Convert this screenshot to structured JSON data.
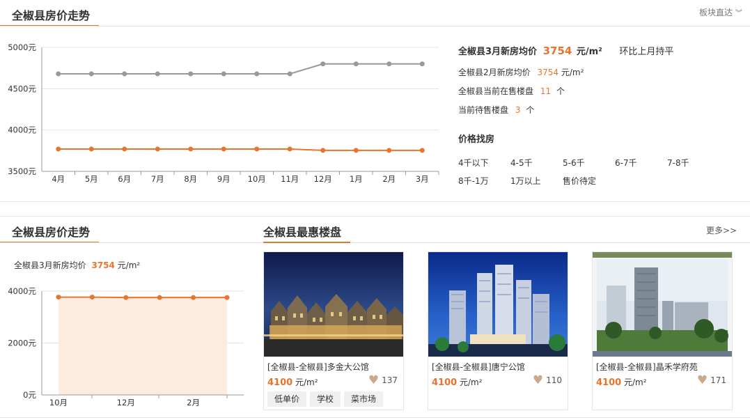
{
  "top": {
    "title": "全椒县房价走势",
    "nav_link": "板块直达",
    "chart_data": {
      "type": "line",
      "categories": [
        "4月",
        "5月",
        "6月",
        "7月",
        "8月",
        "9月",
        "10月",
        "11月",
        "12月",
        "1月",
        "2月",
        "3月"
      ],
      "y_ticks": [
        "5000元",
        "4500元",
        "4000元",
        "3500元"
      ],
      "ylim": [
        3500,
        5000
      ],
      "grid": true,
      "series": [
        {
          "color": "#999999",
          "values": [
            4680,
            4680,
            4680,
            4680,
            4680,
            4680,
            4680,
            4680,
            4800,
            4800,
            4800,
            4800
          ]
        },
        {
          "color": "#e8742e",
          "values": [
            3770,
            3770,
            3770,
            3770,
            3770,
            3770,
            3770,
            3770,
            3754,
            3754,
            3754,
            3754
          ]
        }
      ]
    },
    "summary": {
      "march_label": "全椒县3月新房均价",
      "march_price": "3754",
      "unit": "元/m²",
      "mom": "环比上月持平",
      "feb_label": "全椒县2月新房均价",
      "feb_price": "3754",
      "feb_unit": "元/m²",
      "on_sale_label": "全椒县当前在售楼盘",
      "on_sale_count": "11",
      "on_sale_unit": "个",
      "pending_label": "当前待售楼盘",
      "pending_count": "3",
      "pending_unit": "个"
    },
    "price_filter": {
      "heading": "价格找房",
      "options": [
        "4千以下",
        "4-5千",
        "5-6千",
        "6-7千",
        "7-8千",
        "8千-1万",
        "1万以上",
        "售价待定"
      ]
    }
  },
  "bottom_left": {
    "title": "全椒县房价走势",
    "avg_label": "全椒县3月新房均价",
    "avg_price": "3754",
    "avg_unit": "元/m²",
    "chart_data": {
      "type": "area",
      "x": [
        "10月",
        "11月",
        "12月",
        "1月",
        "2月",
        "3月"
      ],
      "x_tick_labels": [
        "10月",
        "12月",
        "2月"
      ],
      "y_ticks": [
        "4000元",
        "2000元",
        "0元"
      ],
      "ylim": [
        0,
        4000
      ],
      "grid": true,
      "series": [
        {
          "color": "#e8742e",
          "values": [
            3770,
            3770,
            3754,
            3754,
            3754,
            3754
          ]
        }
      ]
    }
  },
  "bottom_right": {
    "title": "全椒县最惠楼盘",
    "more_link": "更多>>",
    "cards": [
      {
        "name": "[全椒县-全椒县]多金大公馆",
        "price": "4100",
        "unit": "元/m²",
        "likes": "137",
        "tags": [
          "低单价",
          "学校",
          "菜市场"
        ]
      },
      {
        "name": "[全椒县-全椒县]唐宁公馆",
        "price": "4100",
        "unit": "元/m²",
        "likes": "110",
        "tags": []
      },
      {
        "name": "[全椒县-全椒县]晶禾学府苑",
        "price": "4100",
        "unit": "元/m²",
        "likes": "171",
        "tags": []
      }
    ]
  }
}
